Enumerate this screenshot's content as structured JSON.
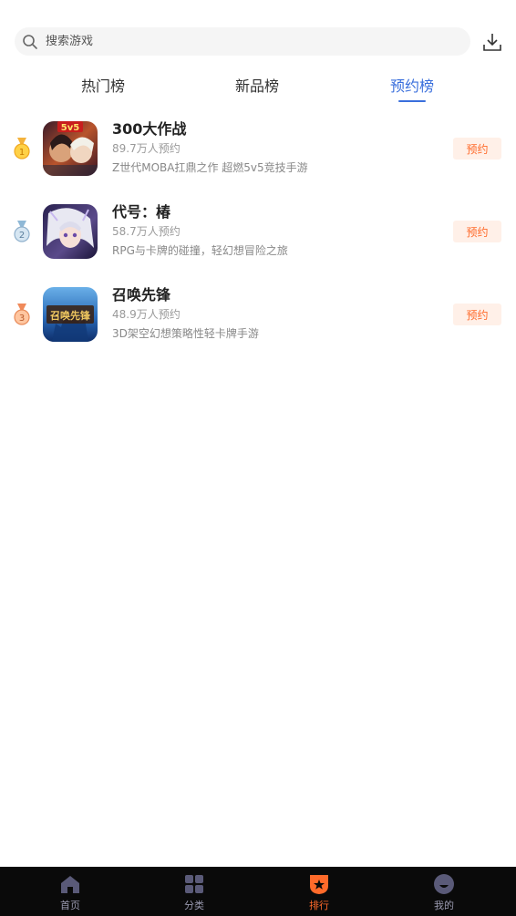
{
  "header": {
    "search_placeholder": "搜索游戏",
    "search_icon": "search-icon",
    "download_icon": "download-icon"
  },
  "tabs": [
    {
      "label": "热门榜",
      "active": false
    },
    {
      "label": "新品榜",
      "active": false
    },
    {
      "label": "预约榜",
      "active": true
    }
  ],
  "colors": {
    "accent_blue": "#3a6fdc",
    "accent_orange": "#ff6a2a",
    "nav_background": "#0a0a0a"
  },
  "games": [
    {
      "rank": "1",
      "rank_icon": "gold-medal-icon",
      "name": "300大作战",
      "count": "89.7万人预约",
      "desc": "Z世代MOBA扛鼎之作 超燃5v5竞技手游",
      "button": "预约",
      "icon_badge": "5v5"
    },
    {
      "rank": "2",
      "rank_icon": "silver-medal-icon",
      "name": "代号：椿",
      "count": "58.7万人预约",
      "desc": "RPG与卡牌的碰撞，轻幻想冒险之旅",
      "button": "预约"
    },
    {
      "rank": "3",
      "rank_icon": "bronze-medal-icon",
      "name": "召唤先锋",
      "count": "48.9万人预约",
      "desc": "3D架空幻想策略性轻卡牌手游",
      "button": "预约",
      "icon_text": "召唤先锋"
    }
  ],
  "bottom_nav": [
    {
      "label": "首页",
      "icon": "home-icon",
      "active": false
    },
    {
      "label": "分类",
      "icon": "grid-icon",
      "active": false
    },
    {
      "label": "排行",
      "icon": "ranking-icon",
      "active": true
    },
    {
      "label": "我的",
      "icon": "profile-icon",
      "active": false
    }
  ]
}
